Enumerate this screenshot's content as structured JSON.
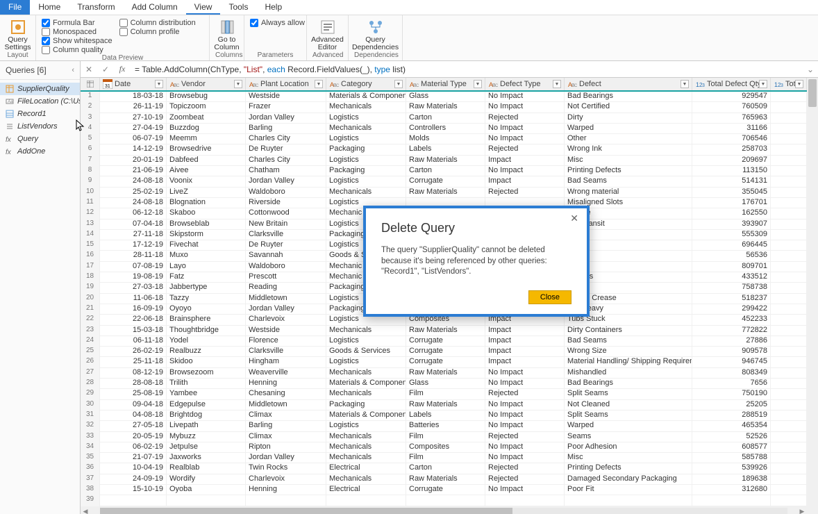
{
  "menu": [
    "File",
    "Home",
    "Transform",
    "Add Column",
    "View",
    "Tools",
    "Help"
  ],
  "menu_active": 4,
  "ribbon": {
    "layout": {
      "label": "Layout",
      "query_settings_top": "Query",
      "query_settings_bot": "Settings"
    },
    "dataprev": {
      "label": "Data Preview",
      "col1": [
        {
          "l": "Formula Bar",
          "c": true
        },
        {
          "l": "Monospaced",
          "c": false
        },
        {
          "l": "Show whitespace",
          "c": true
        },
        {
          "l": "Column quality",
          "c": false
        }
      ],
      "col2": [
        {
          "l": "Column distribution",
          "c": false
        },
        {
          "l": "Column profile",
          "c": false
        }
      ]
    },
    "columns": {
      "label": "Columns",
      "goto_top": "Go to",
      "goto_bot": "Column",
      "always": "Always allow"
    },
    "params": {
      "label": "Parameters"
    },
    "advanced": {
      "label": "Advanced",
      "ed_top": "Advanced",
      "ed_bot": "Editor"
    },
    "deps": {
      "label": "Dependencies",
      "q_top": "Query",
      "q_bot": "Dependencies"
    }
  },
  "queries_header": "Queries [6]",
  "queries": [
    {
      "name": "SupplierQuality",
      "ico": "table",
      "sel": true
    },
    {
      "name": "FileLocation (C:\\Users...",
      "ico": "param"
    },
    {
      "name": "Record1",
      "ico": "record"
    },
    {
      "name": "ListVendors",
      "ico": "list"
    },
    {
      "name": "Query",
      "ico": "fx"
    },
    {
      "name": "AddOne",
      "ico": "fx"
    }
  ],
  "formula": {
    "eq": "= ",
    "parts": [
      {
        "t": "fn",
        "v": "Table.AddColumn(ChType, "
      },
      {
        "t": "str",
        "v": "\"List\""
      },
      {
        "t": "fn",
        "v": ", "
      },
      {
        "t": "kw",
        "v": "each"
      },
      {
        "t": "fn",
        "v": " Record.FieldValues(_), "
      },
      {
        "t": "kw",
        "v": "type"
      },
      {
        "t": "fn",
        "v": " list)"
      }
    ]
  },
  "columns": [
    {
      "name": "Date",
      "type": "date",
      "w": "c0",
      "align": "num"
    },
    {
      "name": "Vendor",
      "type": "text",
      "w": "c1"
    },
    {
      "name": "Plant Location",
      "type": "text",
      "w": "c2"
    },
    {
      "name": "Category",
      "type": "text",
      "w": "c3"
    },
    {
      "name": "Material Type",
      "type": "text",
      "w": "c4"
    },
    {
      "name": "Defect Type",
      "type": "text",
      "w": "c5"
    },
    {
      "name": "Defect",
      "type": "text",
      "w": "c6"
    },
    {
      "name": "Total Defect Qty",
      "type": "int",
      "w": "c7",
      "align": "num"
    },
    {
      "name": "Total Dow",
      "type": "int",
      "w": "c8"
    }
  ],
  "rows": [
    [
      "18-03-18",
      "Browsebug",
      "Westside",
      "Materials & Components",
      "Glass",
      "No Impact",
      "Bad Bearings",
      "929547",
      ""
    ],
    [
      "26-11-19",
      "Topiczoom",
      "Frazer",
      "Mechanicals",
      "Raw Materials",
      "No Impact",
      "Not Certified",
      "760509",
      ""
    ],
    [
      "27-10-19",
      "Zoombeat",
      "Jordan Valley",
      "Logistics",
      "Carton",
      "Rejected",
      "Dirty",
      "765963",
      ""
    ],
    [
      "27-04-19",
      "Buzzdog",
      "Barling",
      "Mechanicals",
      "Controllers",
      "No Impact",
      "Warped",
      "31166",
      ""
    ],
    [
      "06-07-19",
      "Meemm",
      "Charles City",
      "Logistics",
      "Molds",
      "No Impact",
      "Other",
      "706546",
      ""
    ],
    [
      "14-12-19",
      "Browsedrive",
      "De Ruyter",
      "Packaging",
      "Labels",
      "Rejected",
      "Wrong Ink",
      "258703",
      ""
    ],
    [
      "20-01-19",
      "Dabfeed",
      "Charles City",
      "Logistics",
      "Raw Materials",
      "Impact",
      "Misc",
      "209697",
      ""
    ],
    [
      "21-06-19",
      "Aivee",
      "Chatham",
      "Packaging",
      "Carton",
      "No Impact",
      "Printing Defects",
      "113150",
      ""
    ],
    [
      "24-08-18",
      "Voonix",
      "Jordan Valley",
      "Logistics",
      "Corrugate",
      "Impact",
      "Bad Seams",
      "514131",
      ""
    ],
    [
      "25-02-19",
      "LiveZ",
      "Waldoboro",
      "Mechanicals",
      "Raw Materials",
      "Rejected",
      "Wrong material",
      "355045",
      ""
    ],
    [
      "24-08-18",
      "Blognation",
      "Riverside",
      "Logistics",
      "",
      "",
      "Misaligned Slots",
      "176701",
      ""
    ],
    [
      "06-12-18",
      "Skaboo",
      "Cottonwood",
      "Mechanic",
      "",
      "",
      "Failure",
      "162550",
      ""
    ],
    [
      "07-04-18",
      "Browseblab",
      "New Britain",
      "Logistics",
      "",
      "",
      "d in Transit",
      "393907",
      ""
    ],
    [
      "27-11-18",
      "Skipstorm",
      "Clarksville",
      "Packaging",
      "",
      "",
      "ation",
      "555309",
      ""
    ],
    [
      "17-12-19",
      "Fivechat",
      "De Ruyter",
      "Logistics",
      "",
      "",
      "ck",
      "696445",
      ""
    ],
    [
      "28-11-18",
      "Muxo",
      "Savannah",
      "Goods & S",
      "",
      "",
      "ms",
      "56536",
      ""
    ],
    [
      "07-08-19",
      "Layo",
      "Waldoboro",
      "Mechanic",
      "",
      "",
      "",
      "809701",
      ""
    ],
    [
      "19-08-19",
      "Fatz",
      "Prescott",
      "Mechanic",
      "",
      "",
      "Defects",
      "433512",
      ""
    ],
    [
      "27-03-18",
      "Jabbertype",
      "Reading",
      "Packaging",
      "",
      "",
      "ects",
      "758738",
      ""
    ],
    [
      "11-06-18",
      "Tazzy",
      "Middletown",
      "Logistics",
      "Corrugate",
      "Impact",
      "Wrong Crease",
      "518237",
      ""
    ],
    [
      "16-09-19",
      "Oyoyo",
      "Jordan Valley",
      "Packaging",
      "Carton",
      "Impact",
      "Too Heavy",
      "299422",
      ""
    ],
    [
      "22-06-18",
      "Brainsphere",
      "Charlevoix",
      "Logistics",
      "Composites",
      "Impact",
      "Tubs Stuck",
      "452233",
      ""
    ],
    [
      "15-03-18",
      "Thoughtbridge",
      "Westside",
      "Mechanicals",
      "Raw Materials",
      "Impact",
      "Dirty Containers",
      "772822",
      ""
    ],
    [
      "06-11-18",
      "Yodel",
      "Florence",
      "Logistics",
      "Corrugate",
      "Impact",
      "Bad Seams",
      "27886",
      ""
    ],
    [
      "26-02-19",
      "Realbuzz",
      "Clarksville",
      "Goods & Services",
      "Corrugate",
      "Impact",
      "Wrong  Size",
      "909578",
      ""
    ],
    [
      "25-11-18",
      "Skidoo",
      "Hingham",
      "Logistics",
      "Corrugate",
      "Impact",
      "Material Handling/ Shipping Requirements Error",
      "946745",
      ""
    ],
    [
      "08-12-19",
      "Browsezoom",
      "Weaverville",
      "Mechanicals",
      "Raw Materials",
      "No Impact",
      "Mishandled",
      "808349",
      ""
    ],
    [
      "28-08-18",
      "Trilith",
      "Henning",
      "Materials & Components",
      "Glass",
      "No Impact",
      "Bad Bearings",
      "7656",
      ""
    ],
    [
      "25-08-19",
      "Yambee",
      "Chesaning",
      "Mechanicals",
      "Film",
      "Rejected",
      "Split Seams",
      "750190",
      ""
    ],
    [
      "09-04-18",
      "Edgepulse",
      "Middletown",
      "Packaging",
      "Raw Materials",
      "No Impact",
      "Not Cleaned",
      "25205",
      ""
    ],
    [
      "04-08-18",
      "Brightdog",
      "Climax",
      "Materials & Components",
      "Labels",
      "No Impact",
      "Split Seams",
      "288519",
      ""
    ],
    [
      "27-05-18",
      "Livepath",
      "Barling",
      "Logistics",
      "Batteries",
      "No Impact",
      "Warped",
      "465354",
      ""
    ],
    [
      "20-05-19",
      "Mybuzz",
      "Climax",
      "Mechanicals",
      "Film",
      "Rejected",
      "Seams",
      "52526",
      ""
    ],
    [
      "06-02-19",
      "Jetpulse",
      "Ripton",
      "Mechanicals",
      "Composites",
      "No Impact",
      "Poor  Adhesion",
      "608577",
      ""
    ],
    [
      "21-07-19",
      "Jaxworks",
      "Jordan Valley",
      "Mechanicals",
      "Film",
      "No Impact",
      "Misc",
      "585788",
      ""
    ],
    [
      "10-04-19",
      "Realblab",
      "Twin Rocks",
      "Electrical",
      "Carton",
      "Rejected",
      "Printing Defects",
      "539926",
      ""
    ],
    [
      "24-09-19",
      "Wordify",
      "Charlevoix",
      "Mechanicals",
      "Raw Materials",
      "Rejected",
      "Damaged Secondary Packaging",
      "189638",
      ""
    ],
    [
      "15-10-19",
      "Oyoba",
      "Henning",
      "Electrical",
      "Corrugate",
      "No Impact",
      "Poor Fit",
      "312680",
      ""
    ],
    [
      "",
      "",
      "",
      "",
      "",
      "",
      "",
      "",
      ""
    ]
  ],
  "dialog": {
    "title": "Delete Query",
    "msg": "The query \"SupplierQuality\" cannot be deleted because it's being referenced by other queries: \"Record1\", \"ListVendors\".",
    "close": "Close"
  }
}
